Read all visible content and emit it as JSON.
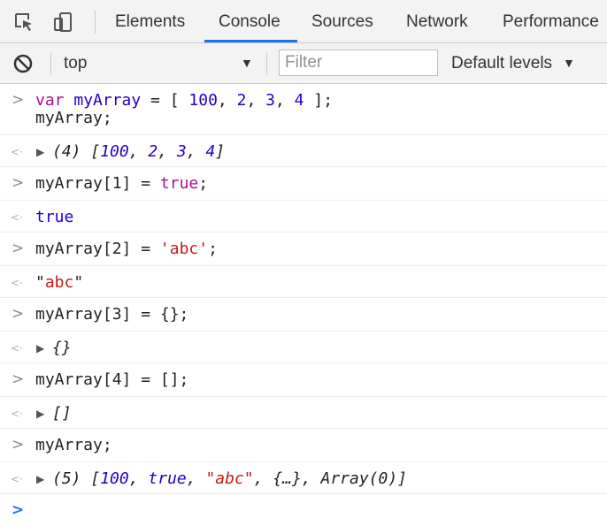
{
  "toolbar": {
    "tabs": [
      {
        "label": "Elements",
        "active": false
      },
      {
        "label": "Console",
        "active": true
      },
      {
        "label": "Sources",
        "active": false
      },
      {
        "label": "Network",
        "active": false
      },
      {
        "label": "Performance",
        "active": false
      }
    ],
    "icons": [
      "inspect-element-icon",
      "device-toolbar-icon"
    ]
  },
  "filterbar": {
    "clear_icon": "clear-console-icon",
    "context": "top",
    "filter_placeholder": "Filter",
    "levels": "Default levels"
  },
  "console": {
    "entries": [
      {
        "input": [
          [
            [
              "var",
              "kw"
            ],
            [
              " ",
              "plain"
            ],
            [
              "myArray",
              "var"
            ],
            [
              " = [ ",
              "plain"
            ],
            [
              "100",
              "num"
            ],
            [
              ", ",
              "plain"
            ],
            [
              "2",
              "num"
            ],
            [
              ", ",
              "plain"
            ],
            [
              "3",
              "num"
            ],
            [
              ", ",
              "plain"
            ],
            [
              "4",
              "num"
            ],
            [
              " ];",
              "plain"
            ]
          ],
          [
            [
              "myArray;",
              "plain"
            ]
          ]
        ],
        "result": [
          [
            "(4) [",
            "plain"
          ],
          [
            "100",
            "num"
          ],
          [
            ", ",
            "plain"
          ],
          [
            "2",
            "num"
          ],
          [
            ", ",
            "plain"
          ],
          [
            "3",
            "num"
          ],
          [
            ", ",
            "plain"
          ],
          [
            "4",
            "num"
          ],
          [
            "]",
            "plain"
          ]
        ],
        "result_expandable": true,
        "result_italic": true
      },
      {
        "input": [
          [
            [
              "myArray[1] = ",
              "plain"
            ],
            [
              "true",
              "kw"
            ],
            [
              ";",
              "plain"
            ]
          ]
        ],
        "result": [
          [
            "true",
            "bool"
          ]
        ],
        "result_expandable": false,
        "result_italic": false
      },
      {
        "input": [
          [
            [
              "myArray[2] = ",
              "plain"
            ],
            [
              "'abc'",
              "str"
            ],
            [
              ";",
              "plain"
            ]
          ]
        ],
        "result": [
          [
            "\"",
            "plain"
          ],
          [
            "abc",
            "str"
          ],
          [
            "\"",
            "plain"
          ]
        ],
        "result_expandable": false,
        "result_italic": false
      },
      {
        "input": [
          [
            [
              "myArray[3] = {};",
              "plain"
            ]
          ]
        ],
        "result": [
          [
            "{}",
            "plain"
          ]
        ],
        "result_expandable": true,
        "result_italic": true
      },
      {
        "input": [
          [
            [
              "myArray[4] = [];",
              "plain"
            ]
          ]
        ],
        "result": [
          [
            "[]",
            "plain"
          ]
        ],
        "result_expandable": true,
        "result_italic": true
      },
      {
        "input": [
          [
            [
              "myArray;",
              "plain"
            ]
          ]
        ],
        "result": [
          [
            "(5) [",
            "plain"
          ],
          [
            "100",
            "num"
          ],
          [
            ", ",
            "plain"
          ],
          [
            "true",
            "bool"
          ],
          [
            ", ",
            "plain"
          ],
          [
            "\"abc\"",
            "str"
          ],
          [
            ", {…}, Array(0)]",
            "plain"
          ]
        ],
        "result_expandable": true,
        "result_italic": true
      }
    ],
    "prompt_symbol": ">",
    "result_symbol": "<·"
  }
}
